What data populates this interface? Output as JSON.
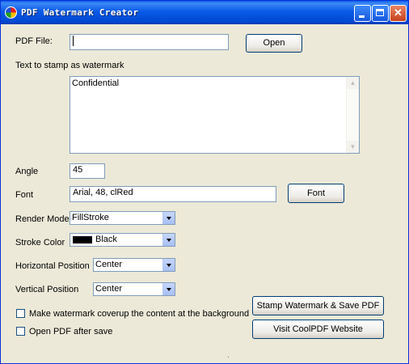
{
  "window": {
    "title": "PDF Watermark Creator",
    "icon": "app-color-wheel-icon"
  },
  "pdf_file": {
    "label": "PDF File:",
    "value": "",
    "open_button": "Open"
  },
  "watermark_text": {
    "label": "Text to stamp as watermark",
    "value": "Confidential"
  },
  "angle": {
    "label": "Angle",
    "value": "45"
  },
  "font": {
    "label": "Font",
    "value": "Arial, 48, clRed",
    "button": "Font"
  },
  "render_mode": {
    "label": "Render Mode",
    "selected": "FillStroke"
  },
  "stroke_color": {
    "label": "Stroke Color",
    "selected": "Black",
    "swatch_color": "#000000"
  },
  "horizontal_position": {
    "label": "Horizontal Position",
    "selected": "Center"
  },
  "vertical_position": {
    "label": "Vertical Position",
    "selected": "Center"
  },
  "options": {
    "coverup_label": "Make watermark coverup the content at the background",
    "coverup_checked": false,
    "open_after_label": "Open PDF after save",
    "open_after_checked": false
  },
  "actions": {
    "stamp_button": "Stamp Watermark & Save PDF",
    "visit_button": "Visit CoolPDF Website"
  }
}
